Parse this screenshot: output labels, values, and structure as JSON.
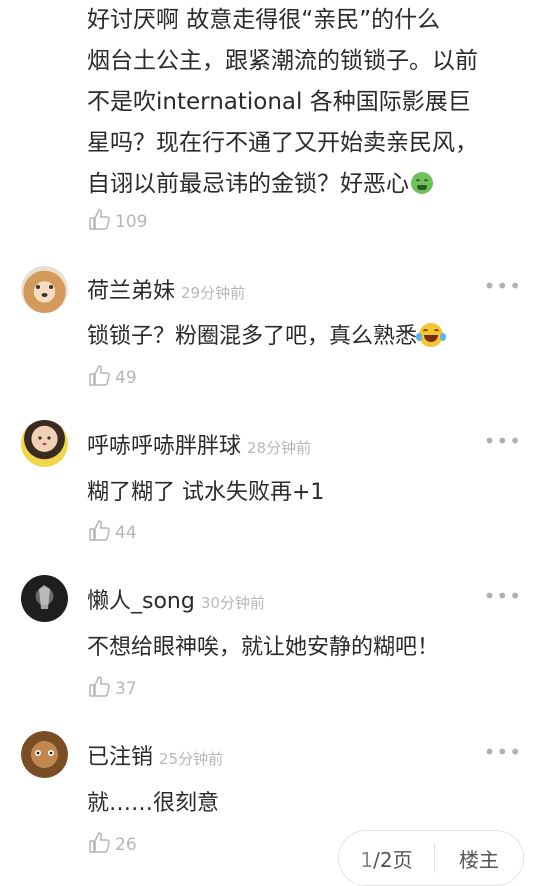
{
  "top_comment": {
    "lines": [
      "好讨厌啊 故意走得很“亲民”的什么",
      "烟台土公主，跟紧潮流的锁锁子。以前",
      "不是吹international 各种国际影展巨",
      "星吗？现在行不通了又开始卖亲民风，",
      "自诩以前最忌讳的金锁？好恶心"
    ],
    "emoji_icon": "nauseated-face-emoji",
    "likes": "109"
  },
  "comments": [
    {
      "name": "荷兰弟妹",
      "time": "29分钟前",
      "text": "锁锁子？粉圈混多了吧，真么熟悉",
      "emoji_icon": "laughing-tears-emoji",
      "likes": "49",
      "more": "•••",
      "avatar_icon": "shiba-dog-avatar"
    },
    {
      "name": "呼哧呼哧胖胖球",
      "time": "28分钟前",
      "text": "糊了糊了 试水失败再+1",
      "likes": "44",
      "more": "•••",
      "avatar_icon": "child-photo-avatar"
    },
    {
      "name": "懒人_song",
      "time": "30分钟前",
      "text": "不想给眼神唉，就让她安静的糊吧！",
      "likes": "37",
      "more": "•••",
      "avatar_icon": "dark-figure-avatar"
    },
    {
      "name": "已注销",
      "time": "25分钟前",
      "text": "就……很刻意",
      "likes": "26",
      "more": "•••",
      "avatar_icon": "cartoon-animal-avatar"
    }
  ],
  "pager": {
    "current": "1",
    "rest": "/2页",
    "floor_label": "楼主"
  },
  "colors": {
    "text": "#2a2a2a",
    "muted": "#b6b6b6",
    "background": "#ffffff"
  }
}
